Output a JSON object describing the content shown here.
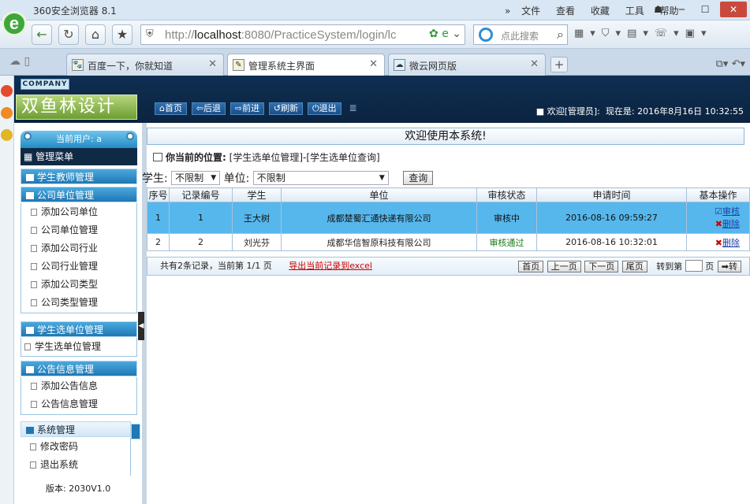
{
  "browser": {
    "title": "360安全浏览器 8.1",
    "menu": [
      "文件",
      "查看",
      "收藏",
      "工具",
      "帮助"
    ],
    "url_host": "localhost",
    "url_rest": ":8080/PracticeSystem/login/lc",
    "url_scheme": "http://",
    "search_placeholder": "点此搜索",
    "tabs": [
      {
        "label": "百度一下，你就知道",
        "active": false
      },
      {
        "label": "管理系统主界面",
        "active": true
      },
      {
        "label": "微云网页版",
        "active": false
      }
    ]
  },
  "header": {
    "company": "COMPANY",
    "brand": "双鱼林设计",
    "nav": [
      "首页",
      "后退",
      "前进",
      "刷新",
      "退出"
    ],
    "nav_icons": [
      "home-icon",
      "back-arrow-icon",
      "forward-arrow-icon",
      "refresh-icon",
      "power-icon"
    ],
    "welcome": "欢迎[管理员]:",
    "now_label": "现在是:",
    "datetime": "2016年8月16日 10:32:55"
  },
  "sidebar": {
    "current_user": "当前用户: a",
    "menu_title": "管理菜单",
    "sections": [
      {
        "title": "学生教师管理",
        "items": []
      },
      {
        "title": "公司单位管理",
        "items": [
          "添加公司单位",
          "公司单位管理",
          "添加公司行业",
          "公司行业管理",
          "添加公司类型",
          "公司类型管理"
        ]
      },
      {
        "title": "学生选单位管理",
        "items": [
          "学生选单位管理"
        ]
      },
      {
        "title": "公告信息管理",
        "items": [
          "添加公告信息",
          "公告信息管理"
        ]
      },
      {
        "title": "系统管理",
        "items": [
          "修改密码",
          "退出系统"
        ]
      }
    ],
    "version": "版本: 2030V1.0"
  },
  "main": {
    "title": "欢迎使用本系统!",
    "crumb_label": "你当前的位置:",
    "crumb_path": "[学生选单位管理]-[学生选单位查询]",
    "filter_student_label": "学生:",
    "filter_student_value": "不限制",
    "filter_unit_label": "单位:",
    "filter_unit_value": "不限制",
    "query_button": "查询",
    "columns": [
      "序号",
      "记录编号",
      "学生",
      "单位",
      "审核状态",
      "申请时间",
      "基本操作"
    ],
    "rows": [
      {
        "no": "1",
        "record": "1",
        "student": "王大树",
        "unit": "成都楚蜀汇通快递有限公司",
        "status": "审核中",
        "time": "2016-08-16 09:59:27",
        "op1": "审核",
        "op2": "删除"
      },
      {
        "no": "2",
        "record": "2",
        "student": "刘光芬",
        "unit": "成都华信智原科技有限公司",
        "status": "审核通过",
        "time": "2016-08-16 10:32:01",
        "op2": "删除"
      }
    ],
    "pager_summary": "共有2条记录，当前第 1/1 页",
    "export_link": "导出当前记录到excel",
    "pager_buttons": [
      "首页",
      "上一页",
      "下一页",
      "尾页"
    ],
    "goto_label": "转到第",
    "page_unit": "页",
    "goto_button": "➡转"
  }
}
